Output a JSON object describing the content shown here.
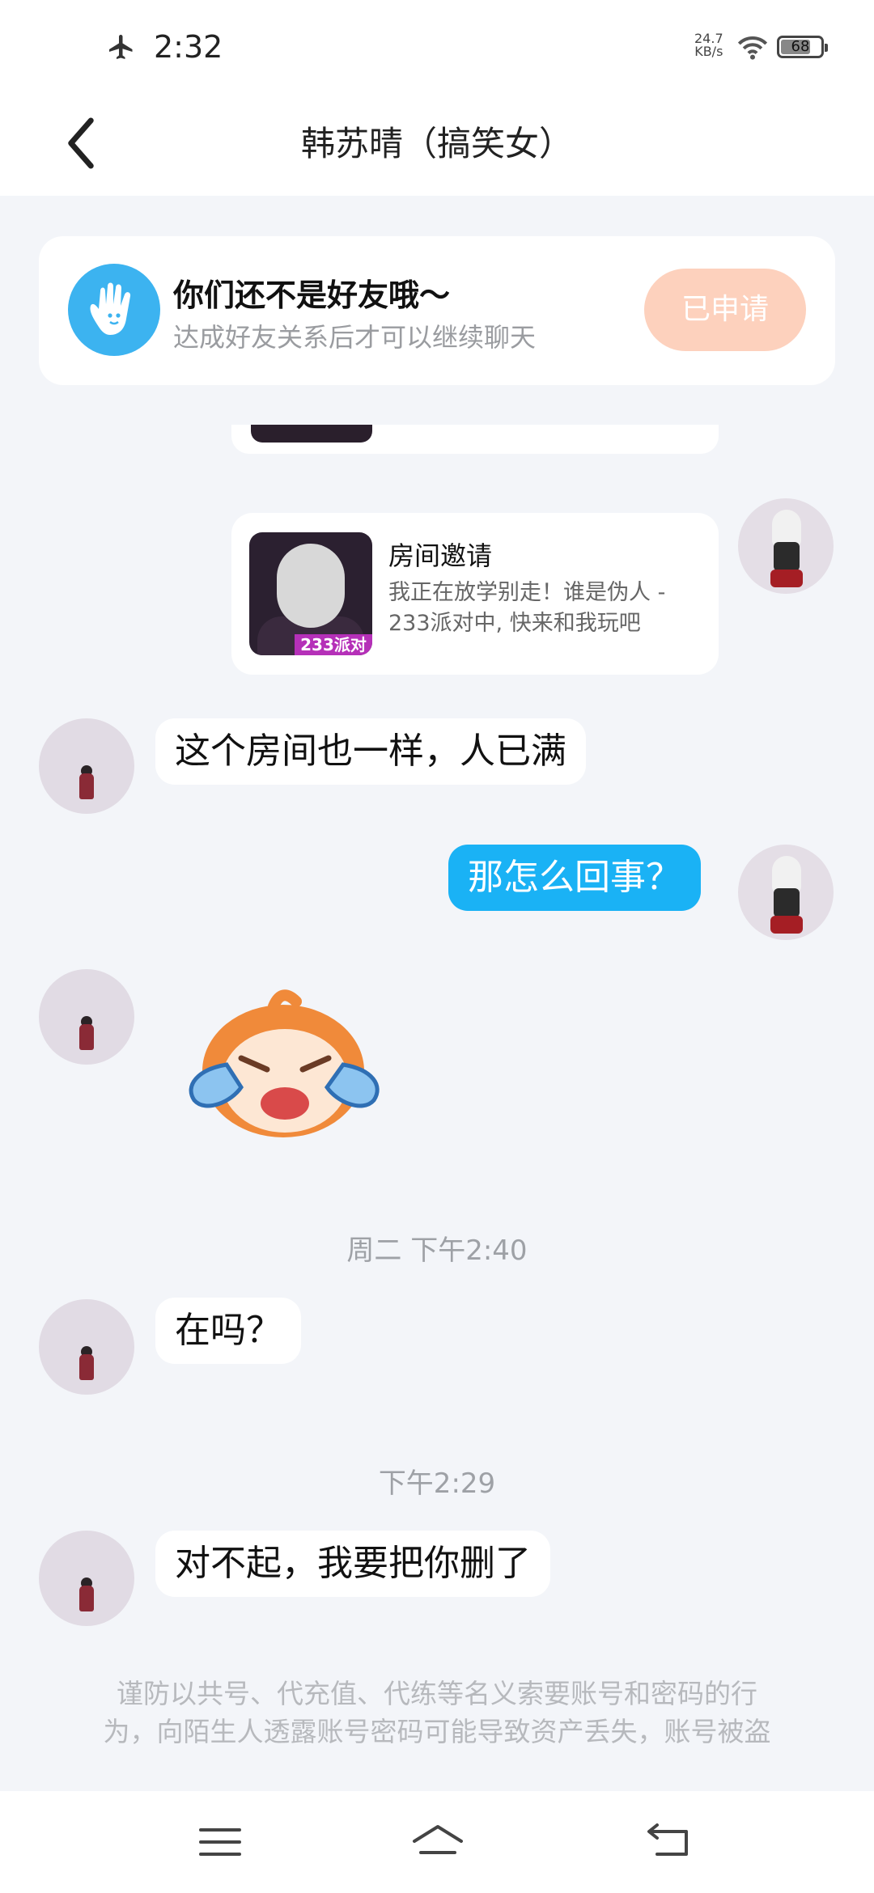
{
  "status_bar": {
    "time": "2:32",
    "net_speed_value": "24.7",
    "net_speed_unit": "KB/s",
    "battery": "68"
  },
  "header": {
    "title": "韩苏晴（搞笑女）"
  },
  "friend_notice": {
    "title": "你们还不是好友哦～",
    "subtitle": "达成好友关系后才可以继续聊天",
    "button_label": "已申请"
  },
  "invite_card": {
    "title": "房间邀请",
    "desc_line1": "我正在放学别走！谁是伪人 -",
    "desc_line2": "233派对中, 快来和我玩吧",
    "thumb_tag": "233派对"
  },
  "messages": [
    {
      "text": "这个房间也一样，人已满"
    },
    {
      "text": "那怎么回事？"
    },
    {
      "text": "在吗？"
    },
    {
      "text": "对不起，我要把你删了"
    }
  ],
  "timestamps": [
    "周二 下午2:40",
    "下午2:29"
  ],
  "warning": {
    "line1": "谨防以共号、代充值、代练等名义索要账号和密码的行",
    "line2": "为，向陌生人透露账号密码可能导致资产丢失，账号被盗"
  },
  "icons": [
    "airplane-icon",
    "wifi-icon",
    "battery-icon",
    "back-icon",
    "hand-icon",
    "menu-icon",
    "home-icon",
    "back-nav-icon"
  ],
  "colors": {
    "accent_blue": "#1ab2f5",
    "applied_button": "#fdd1bd",
    "background": "#f3f5f9"
  }
}
